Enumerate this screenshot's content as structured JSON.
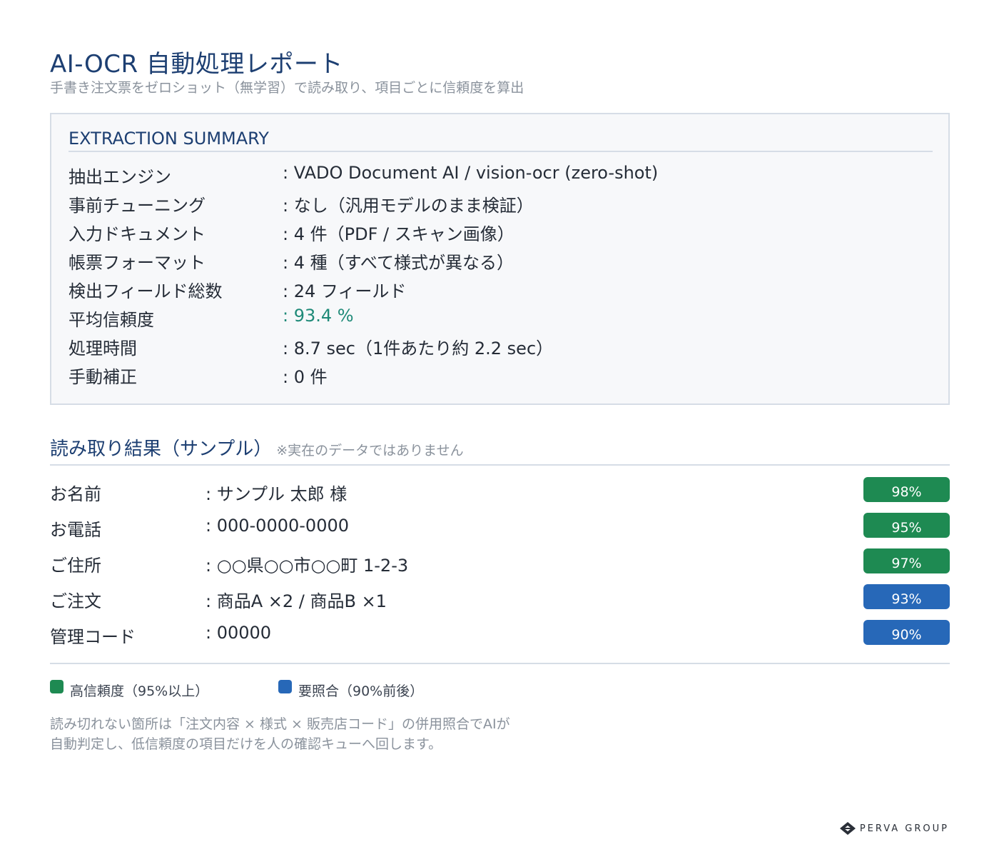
{
  "header": {
    "title": "AI-OCR 自動処理レポート",
    "subtitle": "手書き注文票をゼロショット（無学習）で読み取り、項目ごとに信頼度を算出"
  },
  "summary": {
    "heading": "EXTRACTION SUMMARY",
    "rows": [
      {
        "label": "抽出エンジン",
        "value": ": VADO Document AI / vision-ocr (zero-shot)"
      },
      {
        "label": "事前チューニング",
        "value": ": なし（汎用モデルのまま検証）"
      },
      {
        "label": "入力ドキュメント",
        "value": ": 4 件（PDF / スキャン画像）"
      },
      {
        "label": "帳票フォーマット",
        "value": ": 4 種（すべて様式が異なる）"
      },
      {
        "label": "検出フィールド総数",
        "value": ": 24 フィールド"
      },
      {
        "label": "平均信頼度",
        "value": ": 93.4 %"
      },
      {
        "label": "処理時間",
        "value": ": 8.7 sec（1件あたり約 2.2 sec）"
      },
      {
        "label": "手動補正",
        "value": ": 0 件"
      }
    ]
  },
  "results": {
    "heading": "読み取り結果（サンプル）",
    "note": "※実在のデータではありません",
    "rows": [
      {
        "label": "お名前",
        "value": ": サンプル 太郎 様",
        "confidence": "98%"
      },
      {
        "label": "お電話",
        "value": ": 000-0000-0000",
        "confidence": "95%"
      },
      {
        "label": "ご住所",
        "value": ": ○○県○○市○○町 1-2-3",
        "confidence": "97%"
      },
      {
        "label": "ご注文",
        "value": ": 商品A ×2 / 商品B ×1",
        "confidence": "93%"
      },
      {
        "label": "管理コード",
        "value": ": 00000",
        "confidence": "90%"
      }
    ]
  },
  "legend": {
    "high": "高信頼度（95%以上）",
    "check": "要照合（90%前後）"
  },
  "footnote": {
    "line1": "読み切れない箇所は「注文内容 × 様式 × 販売店コード」の併用照合でAIが",
    "line2": "自動判定し、低信頼度の項目だけを人の確認キューへ回します。"
  },
  "brand": {
    "name": "PERVA GROUP"
  },
  "colors": {
    "title": "#1d3f72",
    "accent_value": "#1f8a78",
    "badge_high": "#1e8a52",
    "badge_check": "#2768b8"
  },
  "icons": {
    "brand_logo": "perva-logo-icon"
  }
}
